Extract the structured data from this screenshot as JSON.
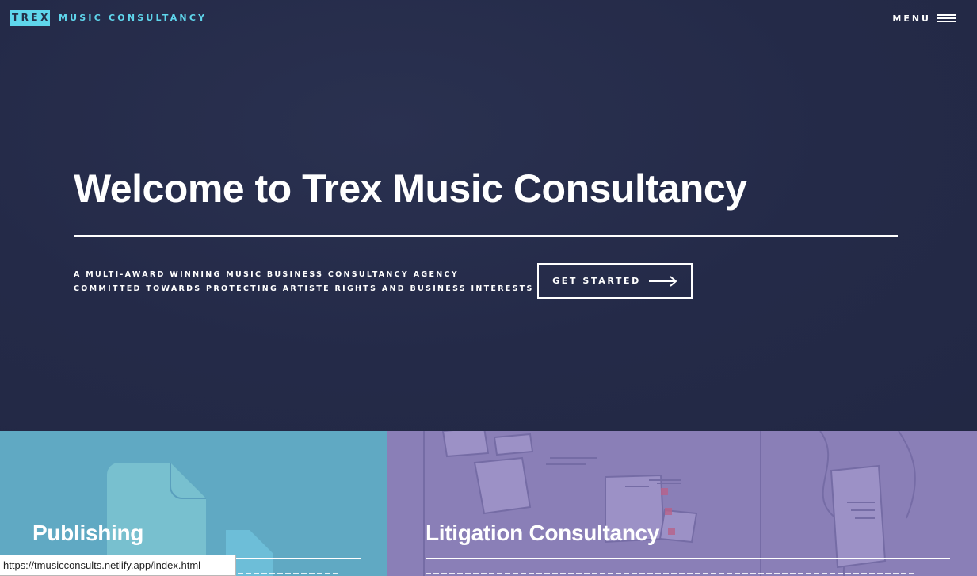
{
  "header": {
    "logo": "TREX",
    "brand": "MUSIC CONSULTANCY",
    "menu_label": "MENU"
  },
  "hero": {
    "title": "Welcome to Trex Music Consultancy",
    "tagline_line1": "A MULTI-AWARD WINNING MUSIC BUSINESS CONSULTANCY AGENCY",
    "tagline_line2": "COMMITTED TOWARDS PROTECTING ARTISTE RIGHTS AND BUSINESS INTERESTS",
    "cta_label": "GET STARTED"
  },
  "services": [
    {
      "title": "Publishing",
      "background": "#60a9c3"
    },
    {
      "title": "Litigation Consultancy",
      "background": "#8a7fb7"
    }
  ],
  "status_bar": {
    "url": "https://tmusicconsults.netlify.app/index.html"
  },
  "colors": {
    "hero_background": "#242a48",
    "accent": "#5fd6ec"
  }
}
